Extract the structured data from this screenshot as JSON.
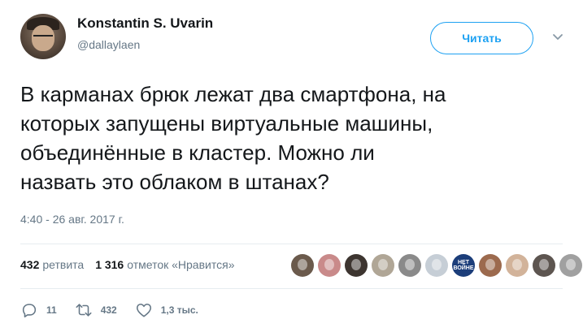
{
  "user": {
    "name": "Konstantin S. Uvarin",
    "handle": "@dallaylaen"
  },
  "follow_label": "Читать",
  "tweet": {
    "text": "В карманах брюк лежат два смартфона, на\nкоторых запущены виртуальные машины,\nобъединённые в кластер. Можно ли\nназвать это облаком в штанах?",
    "timestamp": "4:40 - 26 авг. 2017 г."
  },
  "stats": {
    "retweets_count": "432",
    "retweets_label": "ретвита",
    "likes_count": "1 316",
    "likes_label": "отметок «Нравится»"
  },
  "liker_avatars": [
    {
      "color": "#6b5a4c"
    },
    {
      "color": "#c98a8a"
    },
    {
      "color": "#3d3530"
    },
    {
      "color": "#b0a696"
    },
    {
      "color": "#8a8a8a"
    },
    {
      "color": "#c6ced6"
    },
    {
      "color": "#1c3e7a",
      "text": "НЕТ ВОЙНЕ"
    },
    {
      "color": "#9c6a4e"
    },
    {
      "color": "#d2b39a"
    },
    {
      "color": "#5d5550"
    },
    {
      "color": "#a0a0a0"
    }
  ],
  "actions": {
    "replies": "11",
    "retweets": "432",
    "likes": "1,3 тыс."
  },
  "colors": {
    "accent": "#1da1f2",
    "secondary_text": "#657786",
    "divider": "#e6ecf0"
  }
}
